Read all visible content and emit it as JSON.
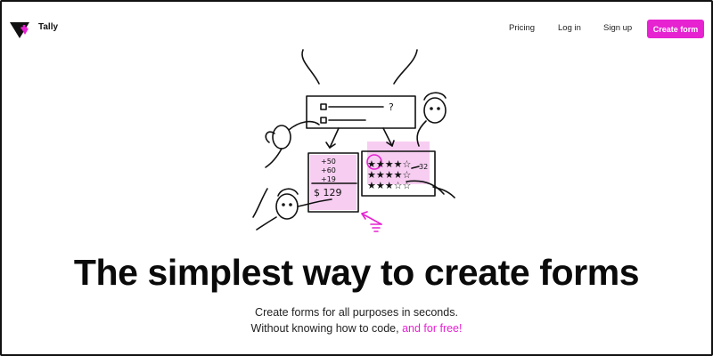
{
  "colors": {
    "accent": "#e622d1",
    "text": "#111111",
    "background": "#ffffff"
  },
  "header": {
    "brand": "Tally",
    "logo_icon": "tally-logo-icon",
    "nav": {
      "pricing": "Pricing",
      "login": "Log in",
      "signup": "Sign up"
    },
    "cta_label": "Create form"
  },
  "hero": {
    "illustration_icon": "form-sketch-illustration",
    "calc_lines": [
      "+50",
      "+60",
      "+19",
      "$ 129"
    ],
    "rating_number": "32",
    "question_mark": "?",
    "title": "The simplest way to create forms",
    "subtitle_line1": "Create forms for all purposes in seconds.",
    "subtitle_line2": "Without knowing how to code,",
    "subtitle_highlight": "and for free!"
  }
}
